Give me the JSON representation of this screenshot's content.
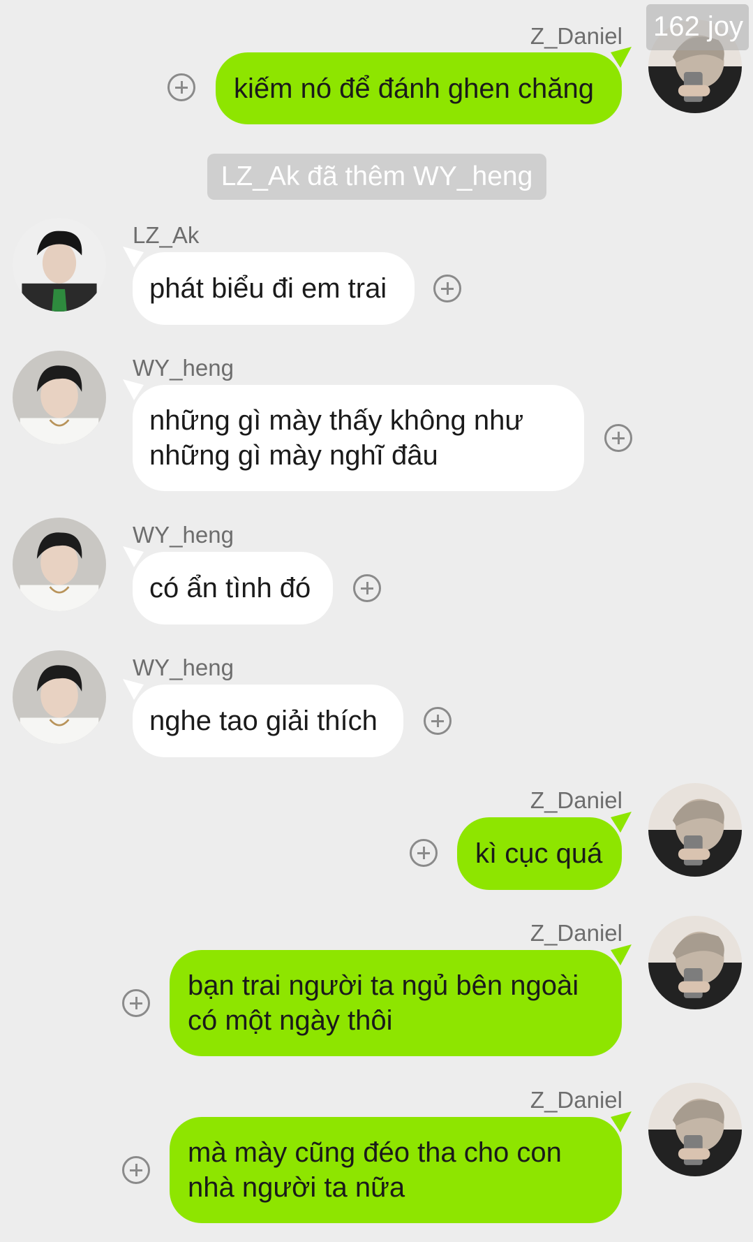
{
  "watermark": "162 joy",
  "system_note": "LZ_Ak đã thêm WY_heng",
  "colors": {
    "background": "#ededed",
    "sent_bubble": "#8ee500",
    "received_bubble": "#ffffff"
  },
  "messages": [
    {
      "sender": "Z_Daniel",
      "text": "kiếm nó để đánh ghen chăng",
      "direction": "outgoing",
      "avatar_icon": "z-daniel-avatar"
    },
    {
      "sender": "LZ_Ak",
      "text": "phát biểu đi em trai",
      "direction": "incoming",
      "avatar_icon": "lz-ak-avatar"
    },
    {
      "sender": "WY_heng",
      "text": "những gì mày thấy không như\nnhững gì mày nghĩ đâu",
      "direction": "incoming",
      "avatar_icon": "wy-heng-avatar"
    },
    {
      "sender": "WY_heng",
      "text": "có ẩn tình đó",
      "direction": "incoming",
      "avatar_icon": "wy-heng-avatar"
    },
    {
      "sender": "WY_heng",
      "text": "nghe tao giải thích",
      "direction": "incoming",
      "avatar_icon": "wy-heng-avatar"
    },
    {
      "sender": "Z_Daniel",
      "text": "kì cục quá",
      "direction": "outgoing",
      "avatar_icon": "z-daniel-avatar"
    },
    {
      "sender": "Z_Daniel",
      "text": "bạn trai người ta ngủ bên ngoài\ncó một ngày thôi",
      "direction": "outgoing",
      "avatar_icon": "z-daniel-avatar"
    },
    {
      "sender": "Z_Daniel",
      "text": "mà mày cũng đéo tha cho con\nnhà người ta nữa",
      "direction": "outgoing",
      "avatar_icon": "z-daniel-avatar"
    }
  ]
}
